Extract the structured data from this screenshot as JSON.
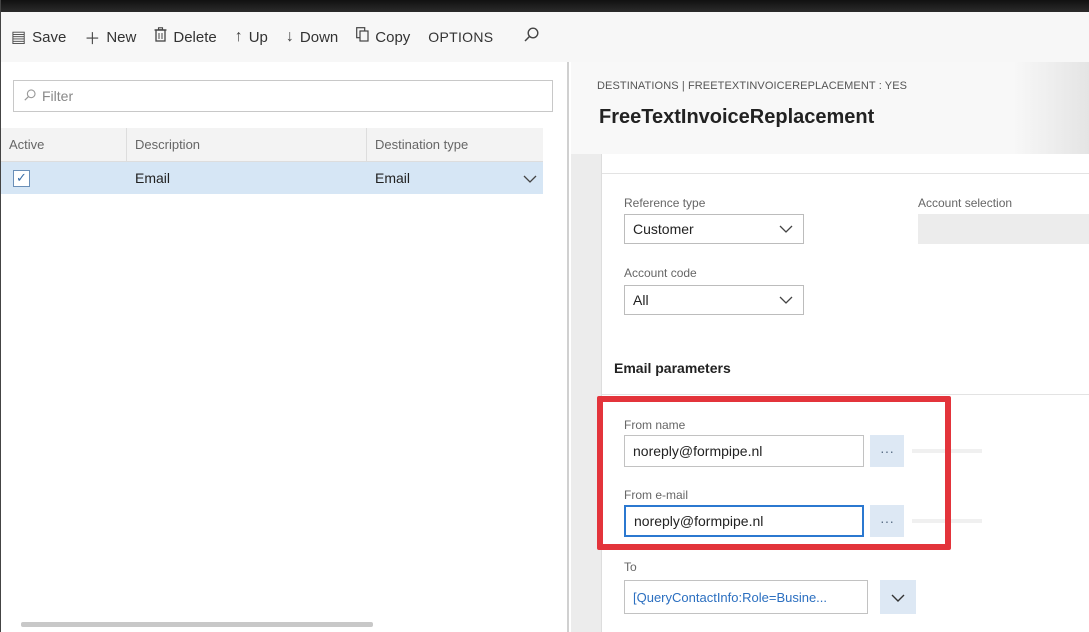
{
  "toolbar": {
    "save": "Save",
    "new": "New",
    "delete": "Delete",
    "up": "Up",
    "down": "Down",
    "copy": "Copy",
    "options": "OPTIONS"
  },
  "icons": {
    "save": "save-icon",
    "new": "plus-icon",
    "delete": "trash-icon",
    "up": "arrow-up-icon",
    "down": "arrow-down-icon",
    "copy": "copy-icon",
    "search": "search-icon",
    "chevron": "chevron-down-icon"
  },
  "filter": {
    "placeholder": "Filter"
  },
  "grid": {
    "columns": [
      "Active",
      "Description",
      "Destination type"
    ],
    "rows": [
      {
        "active": true,
        "description": "Email",
        "destination_type": "Email"
      }
    ]
  },
  "detail": {
    "breadcrumb": "DESTINATIONS  |  FREETEXTINVOICEREPLACEMENT : YES",
    "title": "FreeTextInvoiceReplacement",
    "reference_type_label": "Reference type",
    "reference_type_value": "Customer",
    "account_selection_label": "Account selection",
    "account_code_label": "Account code",
    "account_code_value": "All"
  },
  "email": {
    "section_title": "Email parameters",
    "from_name_label": "From name",
    "from_name_value": "noreply@formpipe.nl",
    "from_email_label": "From e-mail",
    "from_email_value": "noreply@formpipe.nl",
    "to_label": "To",
    "to_value": "[QueryContactInfo:Role=Busine...",
    "dots": "···"
  },
  "colors": {
    "highlight_border": "#e3343b",
    "selected_row": "#d6e6f5",
    "link_blue": "#2b6fc0"
  }
}
